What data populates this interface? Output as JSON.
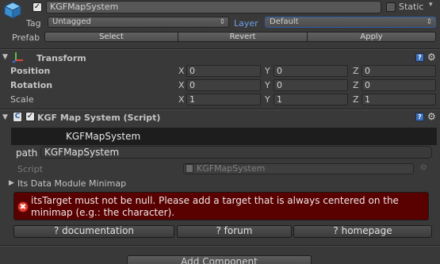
{
  "gameobject": {
    "icon": "gameobject-cube-icon",
    "active": true,
    "name": "KGFMapSystem",
    "static_label": "Static",
    "static_checked": false,
    "tag_label": "Tag",
    "tag_value": "Untagged",
    "layer_label": "Layer",
    "layer_value": "Default",
    "prefab_label": "Prefab",
    "prefab_buttons": [
      "Select",
      "Revert",
      "Apply"
    ]
  },
  "transform": {
    "title": "Transform",
    "icon": "transform-axes-icon",
    "rows": [
      {
        "label": "Position",
        "x": "0",
        "y": "0",
        "z": "0"
      },
      {
        "label": "Rotation",
        "x": "0",
        "y": "0",
        "z": "0"
      },
      {
        "label": "Scale",
        "x": "1",
        "y": "1",
        "z": "1"
      }
    ],
    "axis_labels": [
      "X",
      "Y",
      "Z"
    ]
  },
  "component": {
    "title": "KGF Map System (Script)",
    "enabled": true,
    "icon": "script-icon",
    "panel_title": "KGFMapSystem",
    "path_label": "path",
    "path_value": "KGFMapSystem",
    "script_label": "Script",
    "script_value": "KGFMapSystem",
    "module_label": "Its Data Module Minimap",
    "error_message": "itsTarget must not be null. Please add a target that is always centered on the minimap (e.g.: the character).",
    "buttons": [
      "? documentation",
      "? forum",
      "? homepage"
    ]
  },
  "footer": {
    "add_component_label": "Add Component"
  },
  "colors": {
    "background": "#393939",
    "layer_label": "#6fa0e8",
    "error_bg": "#590000",
    "selection_blue": "#3d6fb8"
  }
}
